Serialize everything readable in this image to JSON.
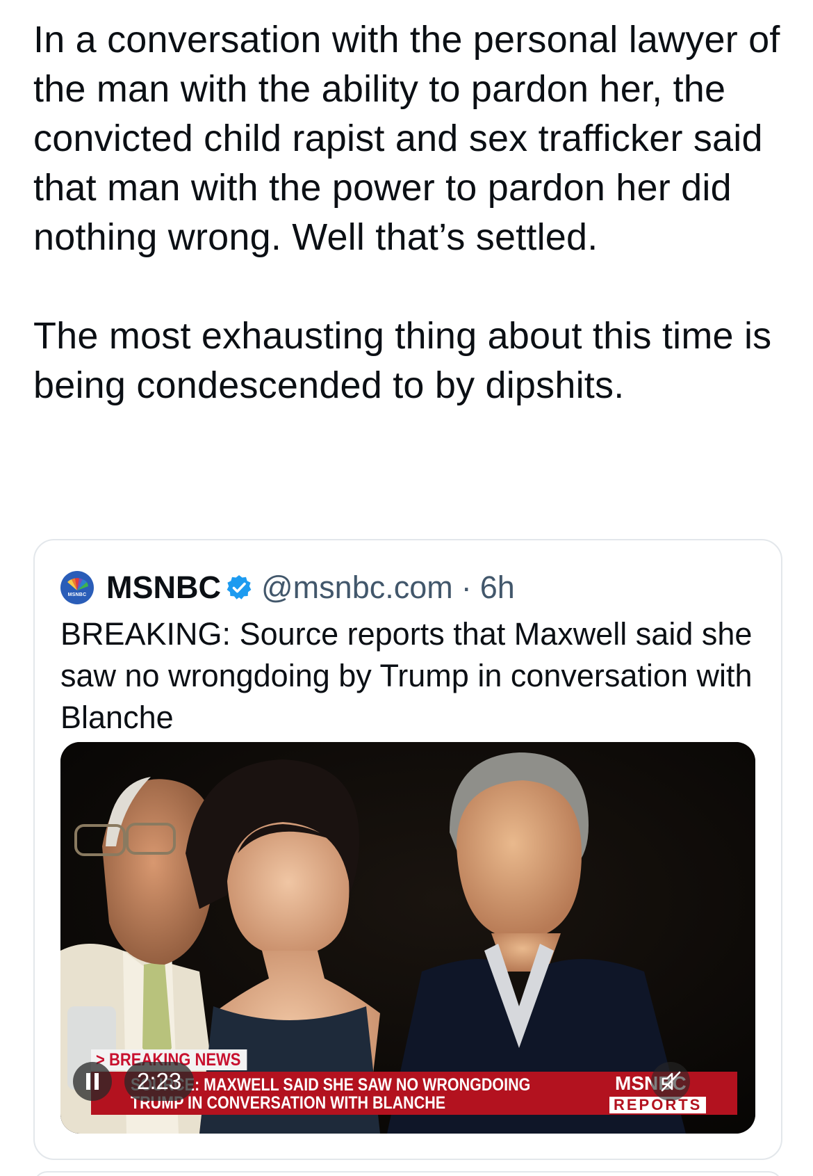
{
  "post": {
    "paragraph_1": "In a conversation with the personal lawyer of the man with the ability to pardon her, the convicted child rapist and sex trafficker said that man with the power to pardon her did nothing wrong. Well that’s settled.",
    "paragraph_2": "The most exhausting thing about this time is being condescended to by dipshits."
  },
  "quoted_post": {
    "avatar_label": "MSNBC",
    "display_name": "MSNBC",
    "handle": "@msnbc.com",
    "separator": "·",
    "time": "6h",
    "text": "BREAKING: Source reports that Maxwell said she saw no wrongdoing by Trump in conversation with Blanche",
    "verified_color": "#1d9bf0"
  },
  "video": {
    "duration": "2:23",
    "play_state": "playing",
    "muted": true,
    "lower_third": {
      "tag": "> BREAKING NEWS",
      "headline_line_1": "SOURCE: MAXWELL SAID SHE SAW NO WRONGDOING",
      "headline_line_2": "TRUMP IN CONVERSATION WITH BLANCHE",
      "logo_top": "MSNBC",
      "logo_bottom": "REPORTS"
    },
    "icons": {
      "pause": "pause-icon",
      "mute": "mute-icon"
    }
  }
}
